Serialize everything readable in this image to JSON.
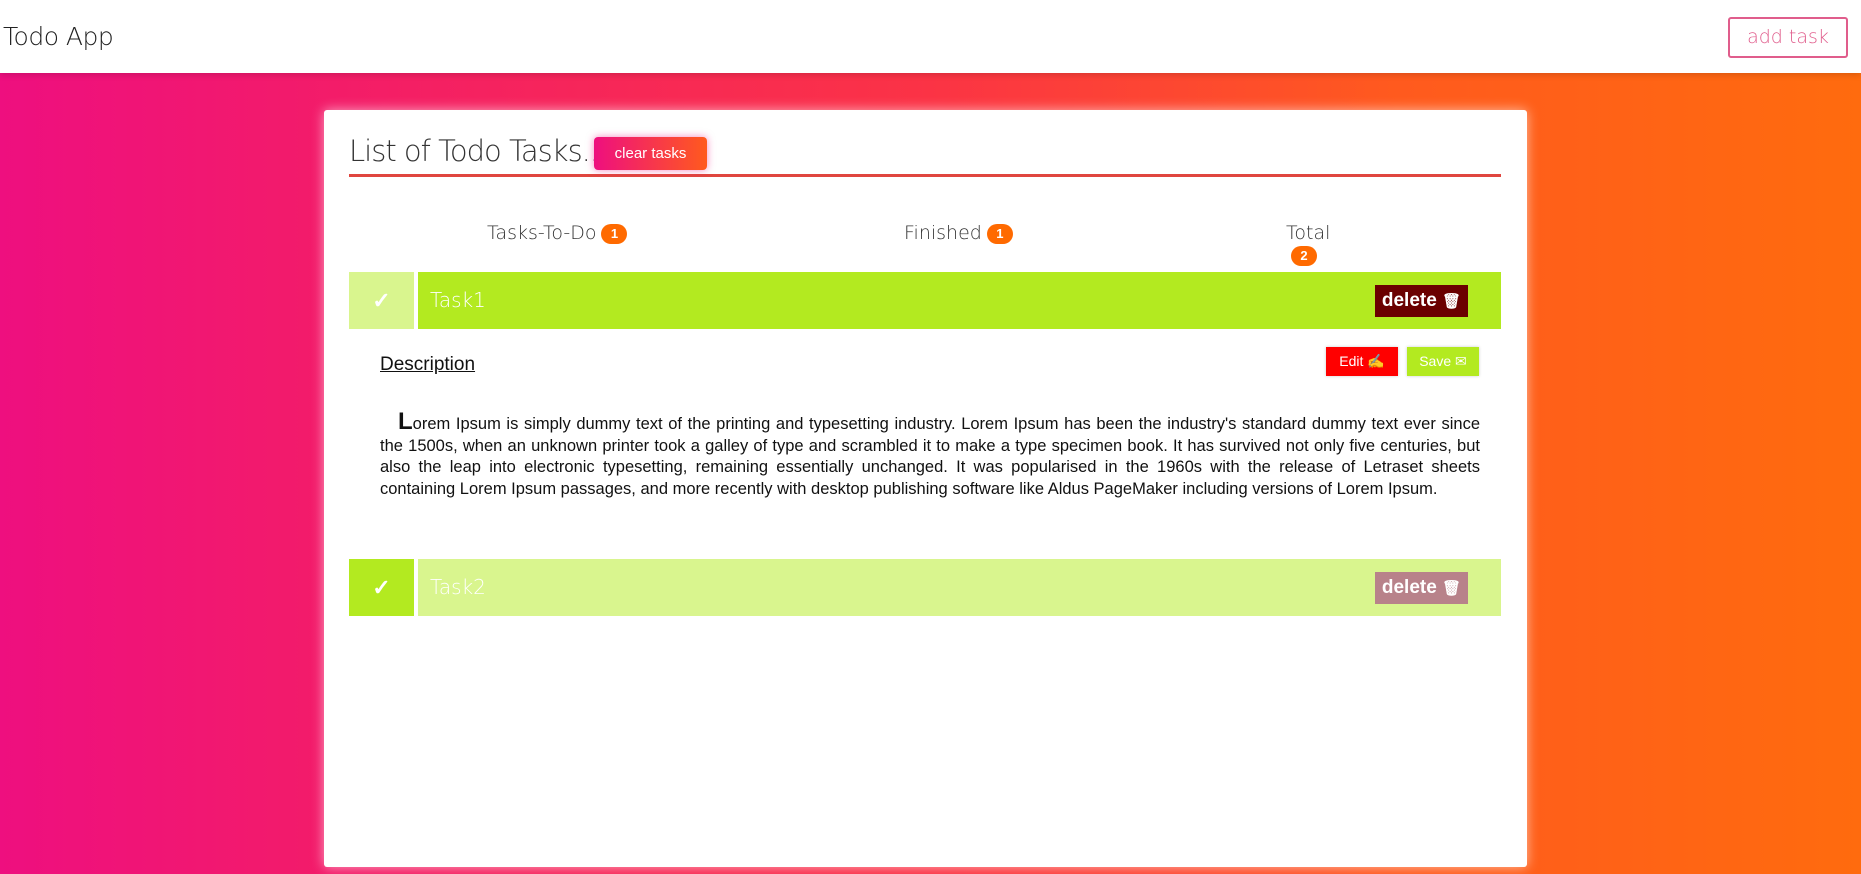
{
  "app": {
    "brand": "Todo App",
    "add_task_label": "add task"
  },
  "card": {
    "title": "List of Todo Tasks...",
    "clear_label": "clear tasks"
  },
  "stats": {
    "todo_label": "Tasks-To-Do",
    "todo_count": "1",
    "finished_label": "Finished",
    "finished_count": "1",
    "total_label": "Total",
    "total_count": "2"
  },
  "tasks": [
    {
      "check": "✓",
      "name": "Task1",
      "delete_label": "delete",
      "delete_icon": "🗑",
      "finished": false
    },
    {
      "check": "✓",
      "name": "Task2",
      "delete_label": "delete",
      "delete_icon": "🗑",
      "finished": true
    }
  ],
  "description": {
    "label": "Description",
    "edit_label": "Edit",
    "edit_icon": "✍",
    "save_label": "Save",
    "save_icon": "✉",
    "dropcap": "L",
    "text": "orem Ipsum is simply dummy text of the printing and typesetting industry. Lorem Ipsum has been the industry's standard dummy text ever since the 1500s, when an unknown printer took a galley of type and scrambled it to make a type specimen book. It has survived not only five centuries, but also the leap into electronic typesetting, remaining essentially unchanged. It was popularised in the 1960s with the release of Letraset sheets containing Lorem Ipsum passages, and more recently with desktop publishing software like Aldus PageMaker including versions of Lorem Ipsum."
  },
  "colors": {
    "green": "#b3ea20",
    "light_green": "#d9f58e",
    "delete_dark": "#6b0000",
    "delete_muted": "#b8828a",
    "badge": "#ff6a00",
    "header_line": "#e0463f"
  }
}
